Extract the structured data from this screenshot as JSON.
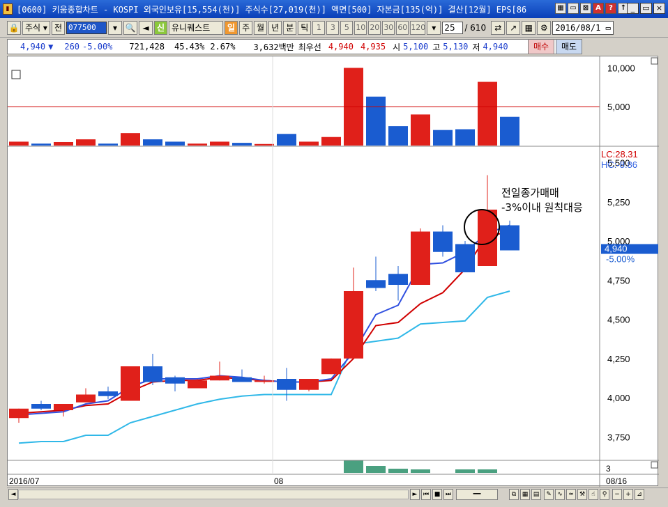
{
  "window": {
    "title": "[0600] 키움종합차트 - KOSPI 외국인보유[15,554(천)] 주식수[27,019(천)] 액면[500] 자본금[135(억)] 결산[12월] EPS[86",
    "app_icon": "chart-app-icon"
  },
  "toolbar": {
    "market_select": "주식",
    "prev_label": "전",
    "stock_code": "077500",
    "new_label": "신",
    "stock_name": "유니퀘스트",
    "period_active": "일",
    "periods": [
      "주",
      "월",
      "년",
      "분",
      "틱"
    ],
    "numbers": [
      "1",
      "3",
      "5",
      "10",
      "20",
      "30",
      "60",
      "120"
    ],
    "display_count": "25",
    "total_count": "/ 610",
    "date": "2016/08/1"
  },
  "quote": {
    "price": "4,940",
    "direction": "▼",
    "change": "260",
    "change_pct": "-5.00%",
    "volume": "721,428",
    "volume_ratio": "45.43%",
    "turnover": "2.67%",
    "amount": "3,632백만",
    "best_label": "최우선",
    "best_ask": "4,940",
    "best_bid": "4,935",
    "open_label": "시",
    "open": "5,100",
    "high_label": "고",
    "high": "5,130",
    "low_label": "저",
    "low": "4,940",
    "buy_label": "매수",
    "sell_label": "매도"
  },
  "volume_panel": {
    "axis_labels": [
      "10,000",
      "5,000"
    ],
    "bars": [
      {
        "v": 500,
        "c": "up"
      },
      {
        "v": 250,
        "c": "down"
      },
      {
        "v": 450,
        "c": "up"
      },
      {
        "v": 800,
        "c": "up"
      },
      {
        "v": 250,
        "c": "down"
      },
      {
        "v": 1600,
        "c": "up"
      },
      {
        "v": 800,
        "c": "down"
      },
      {
        "v": 500,
        "c": "down"
      },
      {
        "v": 250,
        "c": "up"
      },
      {
        "v": 500,
        "c": "up"
      },
      {
        "v": 350,
        "c": "down"
      },
      {
        "v": 200,
        "c": "up"
      },
      {
        "v": 1500,
        "c": "down"
      },
      {
        "v": 500,
        "c": "up"
      },
      {
        "v": 1100,
        "c": "up"
      },
      {
        "v": 10000,
        "c": "up"
      },
      {
        "v": 6300,
        "c": "down"
      },
      {
        "v": 2500,
        "c": "down"
      },
      {
        "v": 4000,
        "c": "up"
      },
      {
        "v": 2000,
        "c": "down"
      },
      {
        "v": 2100,
        "c": "down"
      },
      {
        "v": 8200,
        "c": "up"
      },
      {
        "v": 3700,
        "c": "down"
      }
    ],
    "ref_line": 5000
  },
  "price_panel": {
    "lc_label": "LC:28.31",
    "hc_label": "HC:-8.86",
    "axis_labels": [
      "5,500",
      "5,250",
      "5,000",
      "4,750",
      "4,500",
      "4,250",
      "4,000",
      "3,750"
    ],
    "current_price": "4,940",
    "current_change": "-5.00%",
    "annotation_line1": "전일종가매매",
    "annotation_line2": "-3%이내 원칙대응",
    "bottom_axis_label": "3"
  },
  "chart_data": {
    "type": "candlestick",
    "ylim": [
      3600,
      5600
    ],
    "candles": [
      {
        "o": 3870,
        "h": 3930,
        "l": 3840,
        "c": 3930,
        "dir": "up"
      },
      {
        "o": 3960,
        "h": 3980,
        "l": 3920,
        "c": 3930,
        "dir": "down"
      },
      {
        "o": 3920,
        "h": 3960,
        "l": 3880,
        "c": 3960,
        "dir": "up"
      },
      {
        "o": 3970,
        "h": 4060,
        "l": 3970,
        "c": 4020,
        "dir": "up"
      },
      {
        "o": 4040,
        "h": 4070,
        "l": 3990,
        "c": 4010,
        "dir": "down"
      },
      {
        "o": 3980,
        "h": 4200,
        "l": 3980,
        "c": 4200,
        "dir": "up"
      },
      {
        "o": 4200,
        "h": 4280,
        "l": 4080,
        "c": 4100,
        "dir": "down"
      },
      {
        "o": 4130,
        "h": 4140,
        "l": 4040,
        "c": 4090,
        "dir": "down"
      },
      {
        "o": 4060,
        "h": 4120,
        "l": 4060,
        "c": 4110,
        "dir": "up"
      },
      {
        "o": 4110,
        "h": 4230,
        "l": 4110,
        "c": 4140,
        "dir": "up"
      },
      {
        "o": 4130,
        "h": 4180,
        "l": 4100,
        "c": 4100,
        "dir": "down"
      },
      {
        "o": 4100,
        "h": 4140,
        "l": 4090,
        "c": 4110,
        "dir": "up"
      },
      {
        "o": 4120,
        "h": 4190,
        "l": 3980,
        "c": 4050,
        "dir": "down"
      },
      {
        "o": 4050,
        "h": 4120,
        "l": 4040,
        "c": 4120,
        "dir": "up"
      },
      {
        "o": 4150,
        "h": 4250,
        "l": 4150,
        "c": 4250,
        "dir": "up"
      },
      {
        "o": 4250,
        "h": 4830,
        "l": 4250,
        "c": 4680,
        "dir": "up"
      },
      {
        "o": 4750,
        "h": 4900,
        "l": 4680,
        "c": 4700,
        "dir": "down"
      },
      {
        "o": 4790,
        "h": 4840,
        "l": 4620,
        "c": 4720,
        "dir": "down"
      },
      {
        "o": 4720,
        "h": 5080,
        "l": 4720,
        "c": 5060,
        "dir": "up"
      },
      {
        "o": 5060,
        "h": 5100,
        "l": 4900,
        "c": 4930,
        "dir": "down"
      },
      {
        "o": 4980,
        "h": 5000,
        "l": 4800,
        "c": 4800,
        "dir": "down"
      },
      {
        "o": 4840,
        "h": 5420,
        "l": 4840,
        "c": 5200,
        "dir": "up"
      },
      {
        "o": 5100,
        "h": 5130,
        "l": 4940,
        "c": 4940,
        "dir": "down"
      }
    ],
    "ma_red": [
      3900,
      3910,
      3920,
      3950,
      3960,
      4040,
      4100,
      4110,
      4110,
      4130,
      4120,
      4110,
      4100,
      4100,
      4110,
      4250,
      4460,
      4480,
      4600,
      4670,
      4820,
      5040,
      5050
    ],
    "ma_blue": [
      3890,
      3900,
      3910,
      3960,
      3980,
      4070,
      4120,
      4120,
      4120,
      4140,
      4130,
      4110,
      4100,
      4100,
      4120,
      4290,
      4530,
      4590,
      4850,
      4860,
      4930,
      5050,
      5100
    ],
    "ma_cyan": [
      3710,
      3720,
      3720,
      3760,
      3760,
      3840,
      3880,
      3920,
      3960,
      3990,
      4010,
      4020,
      4020,
      4020,
      4020,
      4340,
      4360,
      4380,
      4470,
      4480,
      4490,
      4640,
      4680
    ],
    "x_labels": [
      "2016/07",
      "08",
      "08/16"
    ]
  },
  "colors": {
    "up": "#e0201a",
    "down": "#1a5cd0",
    "ma_red": "#d00000",
    "ma_blue": "#3050e0",
    "ma_cyan": "#30b8e8"
  }
}
